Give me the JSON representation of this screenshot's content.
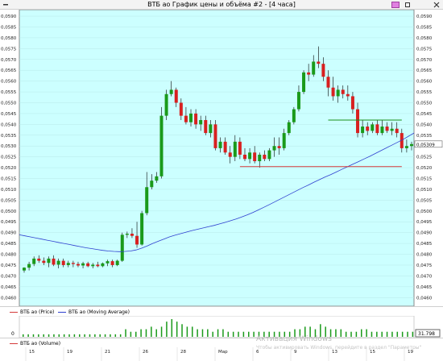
{
  "window": {
    "title": "ВТБ ао График цены и объёма #2 - [4 часа]"
  },
  "chart_data": {
    "type": "candlestick",
    "y_ticks": [
      "0,0460",
      "0,0465",
      "0,0470",
      "0,0475",
      "0,0480",
      "0,0485",
      "0,0490",
      "0,0495",
      "0,0500",
      "0,0505",
      "0,0510",
      "0,0515",
      "0,0520",
      "0,0525",
      "0,0530",
      "0,0535",
      "0,0540",
      "0,0545",
      "0,0550",
      "0,0555",
      "0,0560",
      "0,0565",
      "0,0570",
      "0,0575",
      "0,0580",
      "0,0585",
      "0,0590"
    ],
    "ylim": [
      0.0456,
      0.0593
    ],
    "x_ticks": [
      "15",
      "19",
      "21",
      "26",
      "28",
      "Мар",
      "6",
      "9",
      "13",
      "15",
      "19"
    ],
    "last_price_label": "0,05309",
    "candles": [
      [
        0.04725,
        0.0474,
        0.04715,
        0.04738
      ],
      [
        0.04738,
        0.04765,
        0.04725,
        0.04755
      ],
      [
        0.04755,
        0.0479,
        0.04745,
        0.0478
      ],
      [
        0.0478,
        0.04795,
        0.0476,
        0.0477
      ],
      [
        0.0477,
        0.04785,
        0.0475,
        0.0476
      ],
      [
        0.0476,
        0.0479,
        0.0474,
        0.0478
      ],
      [
        0.0478,
        0.04795,
        0.04745,
        0.04752
      ],
      [
        0.04752,
        0.0478,
        0.04735,
        0.0477
      ],
      [
        0.0477,
        0.0478,
        0.0474,
        0.0475
      ],
      [
        0.0475,
        0.0477,
        0.0474,
        0.0476
      ],
      [
        0.0476,
        0.0477,
        0.0474,
        0.04755
      ],
      [
        0.04755,
        0.04765,
        0.0474,
        0.04748
      ],
      [
        0.04748,
        0.04765,
        0.04735,
        0.04758
      ],
      [
        0.04758,
        0.04765,
        0.0474,
        0.04745
      ],
      [
        0.04745,
        0.0476,
        0.04735,
        0.04752
      ],
      [
        0.04752,
        0.04765,
        0.0474,
        0.04745
      ],
      [
        0.04745,
        0.04762,
        0.0474,
        0.04758
      ],
      [
        0.04758,
        0.04775,
        0.04745,
        0.04768
      ],
      [
        0.04768,
        0.04775,
        0.0474,
        0.0475
      ],
      [
        0.0475,
        0.04775,
        0.04745,
        0.0477
      ],
      [
        0.0477,
        0.049,
        0.04765,
        0.0489
      ],
      [
        0.0489,
        0.04905,
        0.04875,
        0.04895
      ],
      [
        0.04895,
        0.0492,
        0.04875,
        0.04885
      ],
      [
        0.04885,
        0.0495,
        0.0483,
        0.04845
      ],
      [
        0.04845,
        0.05,
        0.0484,
        0.0499
      ],
      [
        0.0499,
        0.0518,
        0.0498,
        0.0511
      ],
      [
        0.0511,
        0.0517,
        0.051,
        0.0514
      ],
      [
        0.0514,
        0.0518,
        0.0513,
        0.0516
      ],
      [
        0.0516,
        0.0548,
        0.0515,
        0.0544
      ],
      [
        0.0544,
        0.0556,
        0.0542,
        0.0554
      ],
      [
        0.0554,
        0.056,
        0.0553,
        0.0556
      ],
      [
        0.0556,
        0.0557,
        0.0548,
        0.055
      ],
      [
        0.055,
        0.0552,
        0.0542,
        0.0544
      ],
      [
        0.0544,
        0.0548,
        0.054,
        0.0541
      ],
      [
        0.0541,
        0.0547,
        0.0539,
        0.0545
      ],
      [
        0.0545,
        0.0547,
        0.0538,
        0.054
      ],
      [
        0.054,
        0.0544,
        0.0537,
        0.0542
      ],
      [
        0.0542,
        0.0544,
        0.0535,
        0.0536
      ],
      [
        0.0536,
        0.0542,
        0.0534,
        0.054
      ],
      [
        0.054,
        0.0542,
        0.0528,
        0.0529
      ],
      [
        0.0529,
        0.0534,
        0.0527,
        0.0532
      ],
      [
        0.0532,
        0.0534,
        0.0526,
        0.0527
      ],
      [
        0.0527,
        0.053,
        0.0522,
        0.0525
      ],
      [
        0.0525,
        0.0535,
        0.0523,
        0.0532
      ],
      [
        0.0532,
        0.0534,
        0.0524,
        0.0526
      ],
      [
        0.0526,
        0.0529,
        0.0523,
        0.0524
      ],
      [
        0.0524,
        0.0529,
        0.0522,
        0.0527
      ],
      [
        0.0527,
        0.053,
        0.0522,
        0.0523
      ],
      [
        0.0523,
        0.0527,
        0.052,
        0.0526
      ],
      [
        0.0526,
        0.0528,
        0.0523,
        0.0524
      ],
      [
        0.0524,
        0.0529,
        0.0523,
        0.0528
      ],
      [
        0.0528,
        0.0534,
        0.0525,
        0.053
      ],
      [
        0.053,
        0.0534,
        0.0526,
        0.0529
      ],
      [
        0.0529,
        0.0538,
        0.0528,
        0.0536
      ],
      [
        0.0536,
        0.0542,
        0.0535,
        0.0541
      ],
      [
        0.0541,
        0.0548,
        0.054,
        0.0547
      ],
      [
        0.0547,
        0.0558,
        0.0546,
        0.0555
      ],
      [
        0.0555,
        0.0565,
        0.0554,
        0.0564
      ],
      [
        0.0564,
        0.0568,
        0.056,
        0.0563
      ],
      [
        0.0563,
        0.0572,
        0.0562,
        0.0569
      ],
      [
        0.0569,
        0.0576,
        0.0566,
        0.0568
      ],
      [
        0.0568,
        0.0571,
        0.056,
        0.0562
      ],
      [
        0.0562,
        0.0565,
        0.0553,
        0.0557
      ],
      [
        0.0557,
        0.0562,
        0.0551,
        0.0553
      ],
      [
        0.0553,
        0.0558,
        0.055,
        0.0556
      ],
      [
        0.0556,
        0.0558,
        0.0552,
        0.0554
      ],
      [
        0.0554,
        0.0558,
        0.0551,
        0.0553
      ],
      [
        0.0553,
        0.0555,
        0.0545,
        0.0547
      ],
      [
        0.0547,
        0.055,
        0.0534,
        0.0536
      ],
      [
        0.0536,
        0.0542,
        0.0534,
        0.0539
      ],
      [
        0.0539,
        0.0541,
        0.0535,
        0.0537
      ],
      [
        0.0537,
        0.0541,
        0.0536,
        0.054
      ],
      [
        0.054,
        0.0542,
        0.0535,
        0.0536
      ],
      [
        0.0536,
        0.0542,
        0.0535,
        0.0539
      ],
      [
        0.0539,
        0.0541,
        0.0536,
        0.0537
      ],
      [
        0.0537,
        0.0541,
        0.0535,
        0.0538
      ],
      [
        0.0538,
        0.0541,
        0.0534,
        0.0536
      ],
      [
        0.0536,
        0.0538,
        0.0527,
        0.0529
      ],
      [
        0.0529,
        0.0533,
        0.0527,
        0.053
      ],
      [
        0.053,
        0.0532,
        0.0528,
        0.05309
      ]
    ],
    "moving_average": [
      0.0489,
      0.04885,
      0.0488,
      0.04875,
      0.0487,
      0.04865,
      0.0486,
      0.04855,
      0.0485,
      0.04845,
      0.0484,
      0.04835,
      0.0483,
      0.04826,
      0.04822,
      0.04818,
      0.04815,
      0.04813,
      0.04812,
      0.04813,
      0.04815,
      0.0482,
      0.04828,
      0.04838,
      0.0485,
      0.0486,
      0.0487,
      0.0488,
      0.04888,
      0.04895,
      0.04902,
      0.04909,
      0.04915,
      0.04921,
      0.04927,
      0.04933,
      0.0494,
      0.04947,
      0.04955,
      0.04963,
      0.04972,
      0.04982,
      0.04993,
      0.05005,
      0.05017,
      0.0503,
      0.05043,
      0.05056,
      0.05069,
      0.05082,
      0.05095,
      0.05108,
      0.0512,
      0.05133,
      0.05145,
      0.05157,
      0.05168,
      0.0518,
      0.05192,
      0.05204,
      0.05216,
      0.05228,
      0.0524,
      0.05252,
      0.05265,
      0.05278,
      0.05291,
      0.05304,
      0.05317,
      0.0533,
      0.05345,
      0.0536
    ],
    "volume": [
      1,
      1,
      1,
      1,
      1,
      1,
      1,
      1,
      1,
      1,
      1,
      1,
      1,
      1,
      1,
      1,
      1,
      1,
      1,
      1,
      3,
      2,
      2,
      3,
      3,
      4,
      3,
      4,
      6,
      7,
      6,
      5,
      4,
      4,
      3,
      3,
      3,
      2,
      3,
      3,
      2,
      2,
      2,
      2,
      2,
      2,
      2,
      2,
      2,
      2,
      2,
      2,
      2,
      3,
      3,
      4,
      4,
      3,
      5,
      4,
      3,
      3,
      3,
      2,
      2,
      2,
      3,
      3,
      2,
      2,
      2,
      2,
      2,
      2,
      2,
      2,
      2
    ],
    "levels": [
      {
        "price": 0.0542,
        "color": "#1a8f1a",
        "from": 62,
        "to": 77
      },
      {
        "price": 0.05205,
        "color": "#d43a3a",
        "from": 44,
        "to": 77
      }
    ],
    "colors": {
      "background": "#ccffff",
      "up": "#1a9a1a",
      "down": "#d82020",
      "ma": "#2f3fcf",
      "volume": "#1a9a1a"
    }
  },
  "legend": {
    "price_label": "ВТБ ао (Price)",
    "ma_label": "ВТБ ао (Moving Average)",
    "volume_label": "ВТБ ао (Volume)"
  },
  "volume_axis": {
    "zero_label": "0",
    "last_value_label": "31.798"
  },
  "watermark": {
    "title": "Активация Windows",
    "subtitle": "Чтобы активировать Windows, перейдите в раздел \"Параметры\""
  }
}
